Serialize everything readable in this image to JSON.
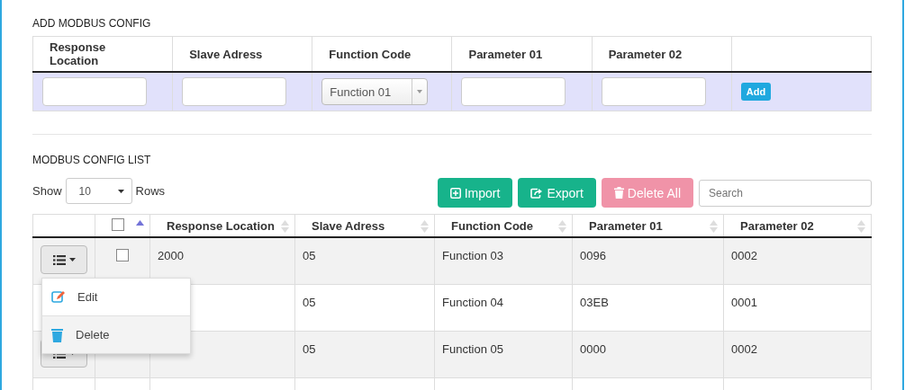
{
  "add_section": {
    "title": "ADD MODBUS CONFIG",
    "columns": [
      "Response Location",
      "Slave Adress",
      "Function Code",
      "Parameter 01",
      "Parameter 02"
    ],
    "function_select": {
      "value": "Function 01"
    },
    "add_button": "Add"
  },
  "list_section": {
    "title": "MODBUS CONFIG LIST",
    "show_label": "Show",
    "rows_select": {
      "value": "10"
    },
    "rows_label": "Rows",
    "buttons": [
      {
        "kind": "import",
        "label": "Import",
        "disabled": false
      },
      {
        "kind": "export",
        "label": "Export",
        "disabled": false
      },
      {
        "kind": "delete",
        "label": "Delete All",
        "disabled": true
      }
    ],
    "search": {
      "placeholder": "Search"
    },
    "table": {
      "select_all": {
        "checked": false,
        "sorted": true
      },
      "columns": [
        {
          "label": "Response Location",
          "sorted": false
        },
        {
          "label": "Slave Adress",
          "sorted": false
        },
        {
          "label": "Function Code",
          "sorted": false
        },
        {
          "label": "Parameter 01",
          "sorted": false
        },
        {
          "label": "Parameter 02",
          "sorted": false
        }
      ],
      "rows": [
        {
          "action_button": true,
          "checked": false,
          "cells": [
            "2000",
            "05",
            "Function 03",
            "0096",
            "0002"
          ]
        },
        {
          "cells": [
            null,
            "05",
            "Function 04",
            "03EB",
            "0001"
          ]
        },
        {
          "action_button": true,
          "cells": [
            null,
            "05",
            "Function 05",
            "0000",
            "0002"
          ]
        }
      ]
    },
    "row_menu": {
      "items": [
        {
          "kind": "edit",
          "label": "Edit",
          "selected": false
        },
        {
          "kind": "delete",
          "label": "Delete",
          "selected": true
        }
      ]
    }
  }
}
